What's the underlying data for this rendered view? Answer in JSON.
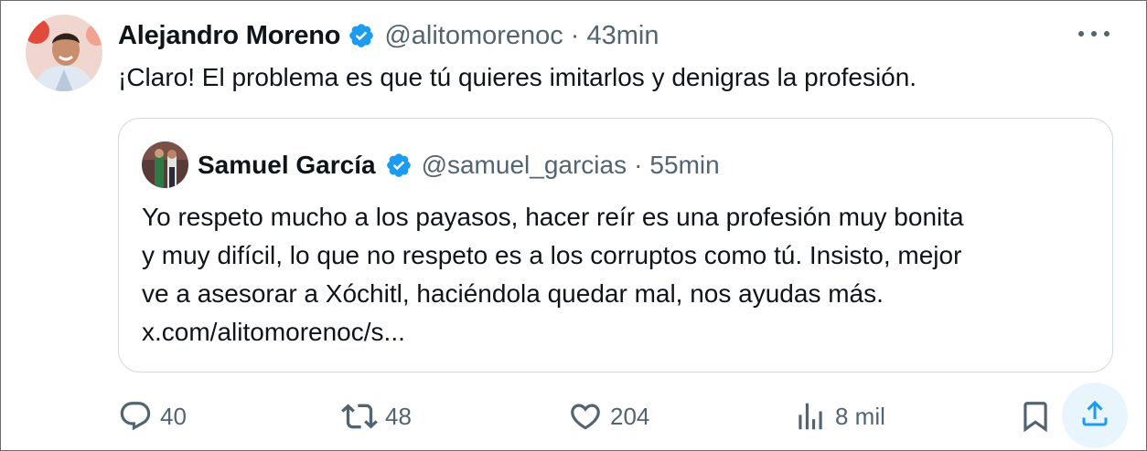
{
  "tweet": {
    "author_name": "Alejandro Moreno",
    "handle": "@alitomorenoc",
    "separator": "·",
    "time": "43min",
    "text": "¡Claro! El problema es que tú quieres imitarlos y denigras la profesión."
  },
  "quoted": {
    "author_name": "Samuel García",
    "handle": "@samuel_garcias",
    "separator": "·",
    "time": "55min",
    "lines": [
      "Yo respeto mucho a los payasos, hacer reír es una profesión muy bonita",
      "y muy difícil, lo que no respeto es a los corruptos como tú. Insisto, mejor",
      "ve a asesorar a Xóchitl, haciéndola quedar mal, nos ayudas más.",
      "x.com/alitomorenoc/s..."
    ]
  },
  "actions": {
    "replies": "40",
    "reposts": "48",
    "likes": "204",
    "views": "8 mil"
  },
  "icons": {
    "verified": "verified-badge-icon",
    "more": "more-icon",
    "reply": "reply-icon",
    "repost": "repost-icon",
    "like": "heart-icon",
    "views": "views-icon",
    "bookmark": "bookmark-icon",
    "share": "share-icon"
  },
  "colors": {
    "verified_blue": "#1d9bf0",
    "secondary_text": "#536471",
    "primary_text": "#0f1419",
    "border": "#cfd9de",
    "share_bg": "#e8f5fd"
  }
}
